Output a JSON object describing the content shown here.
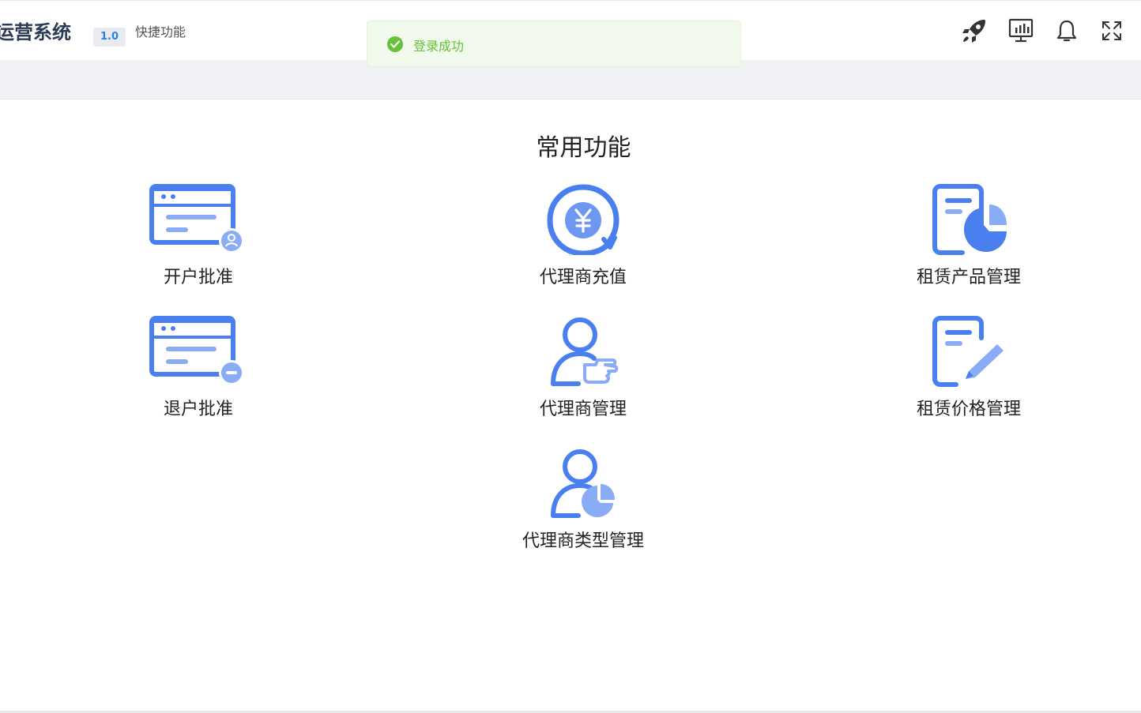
{
  "header": {
    "brand": "运营系统",
    "version": "1.0",
    "shortcut": "快捷功能",
    "icons": [
      "rocket-icon",
      "monitor-chart-icon",
      "bell-icon",
      "fullscreen-icon"
    ]
  },
  "toast": {
    "message": "登录成功",
    "type": "success",
    "color": "#67c23a"
  },
  "main": {
    "title": "常用功能",
    "accent_color": "#4a7ff0",
    "light_color": "#8aabf5",
    "tiles": [
      {
        "label": "开户批准",
        "icon": "window-user-icon"
      },
      {
        "label": "代理商充值",
        "icon": "yuan-coin-icon"
      },
      {
        "label": "租赁产品管理",
        "icon": "doc-pie-icon"
      },
      {
        "label": "退户批准",
        "icon": "window-minus-icon"
      },
      {
        "label": "代理商管理",
        "icon": "user-hand-icon"
      },
      {
        "label": "租赁价格管理",
        "icon": "doc-pencil-icon"
      },
      {
        "label": "代理商类型管理",
        "icon": "user-pie-icon"
      }
    ]
  }
}
